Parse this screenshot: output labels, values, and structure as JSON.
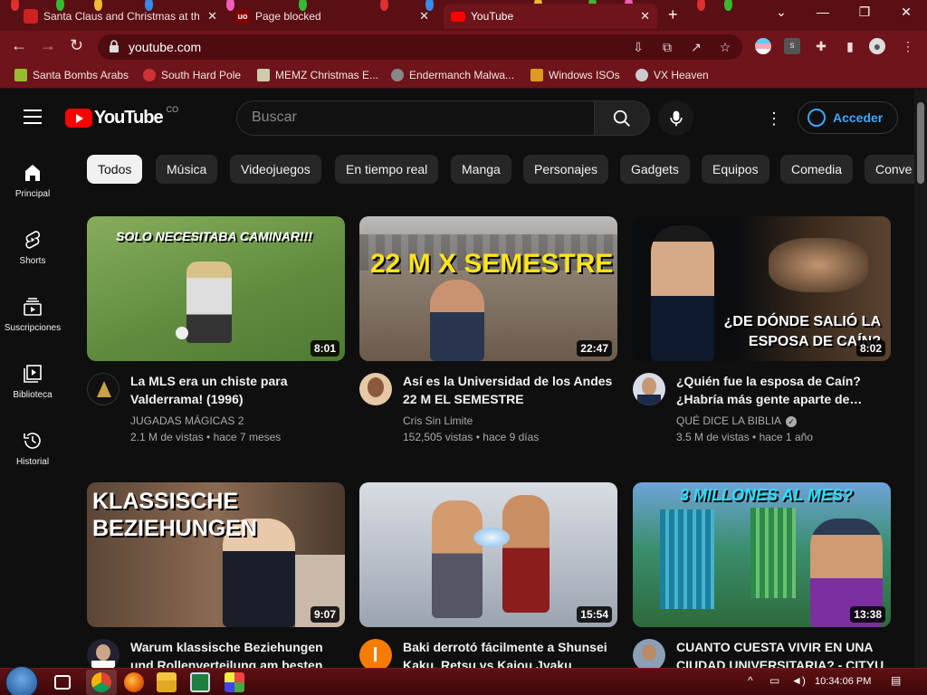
{
  "browser": {
    "tabs": [
      {
        "title": "Santa Claus and Christmas at the",
        "active": false,
        "favicon": "santa-favicon"
      },
      {
        "title": "Page blocked",
        "active": false,
        "favicon": "ublock-favicon"
      },
      {
        "title": "YouTube",
        "active": true,
        "favicon": "youtube-favicon"
      }
    ],
    "url": "youtube.com",
    "bookmarks": [
      {
        "label": "Santa Bombs Arabs"
      },
      {
        "label": "South Hard Pole"
      },
      {
        "label": "MEMZ Christmas E..."
      },
      {
        "label": "Endermanch Malwa..."
      },
      {
        "label": "Windows ISOs"
      },
      {
        "label": "VX Heaven"
      }
    ]
  },
  "youtube": {
    "logo_text": "YouTube",
    "country_code": "CO",
    "search_placeholder": "Buscar",
    "signin_label": "Acceder",
    "sidebar": [
      {
        "label": "Principal",
        "icon": "home-icon"
      },
      {
        "label": "Shorts",
        "icon": "shorts-icon"
      },
      {
        "label": "Suscripciones",
        "icon": "subscriptions-icon"
      },
      {
        "label": "Biblioteca",
        "icon": "library-icon"
      },
      {
        "label": "Historial",
        "icon": "history-icon"
      }
    ],
    "chips": [
      "Todos",
      "Música",
      "Videojuegos",
      "En tiempo real",
      "Manga",
      "Personajes",
      "Gadgets",
      "Equipos",
      "Comedia",
      "Conve"
    ],
    "videos": [
      {
        "title": "La MLS era un chiste para Valderrama! (1996)",
        "channel": "JUGADAS MÁGICAS 2",
        "views": "2.1 M de vistas",
        "age": "hace 7 meses",
        "duration": "8:01",
        "verified": false,
        "thumb_text": "SOLO NECESITABA CAMINAR!!!"
      },
      {
        "title": "Así es la Universidad de los Andes 22 M EL SEMESTRE",
        "channel": "Cris Sin Limite",
        "views": "152,505 vistas",
        "age": "hace 9 días",
        "duration": "22:47",
        "verified": false,
        "thumb_text": "22 M X SEMESTRE"
      },
      {
        "title": "¿Quién fue la esposa de Caín? ¿Habría más gente aparte de…",
        "channel": "QUÉ DICE LA BIBLIA",
        "views": "3.5 M de vistas",
        "age": "hace 1 año",
        "duration": "8:02",
        "verified": true,
        "thumb_text": "¿DE DÓNDE SALIÓ LA ESPOSA DE CAÍN?"
      },
      {
        "title": "Warum klassische Beziehungen und Rollenverteilung am besten",
        "channel": "",
        "views": "",
        "age": "",
        "duration": "9:07",
        "verified": false,
        "thumb_text": "KLASSISCHE BEZIEHUNGEN"
      },
      {
        "title": "Baki derrotó fácilmente a Shunsei Kaku, Retsu vs Kaiou Jyaku",
        "channel": "",
        "views": "",
        "age": "",
        "duration": "15:54",
        "verified": false,
        "thumb_text": ""
      },
      {
        "title": "CUANTO CUESTA VIVIR EN UNA CIUDAD UNIVERSITARIA? - CITYU",
        "channel": "",
        "views": "",
        "age": "",
        "duration": "13:38",
        "verified": false,
        "thumb_text": "3 MILLONES AL MES?"
      }
    ]
  },
  "taskbar": {
    "time": "10:34:06 PM"
  }
}
